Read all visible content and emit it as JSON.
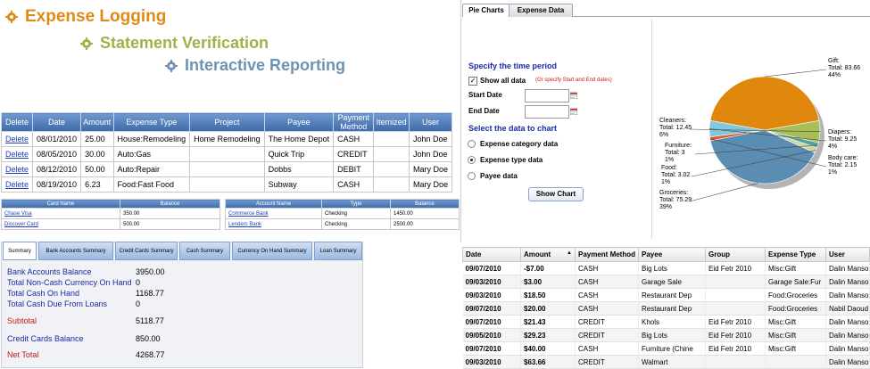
{
  "headings": {
    "h1": "Expense Logging",
    "h2": "Statement Verification",
    "h3": "Interactive Reporting"
  },
  "colors": {
    "h1": "#e08a1a",
    "h2": "#a3b04a",
    "h3": "#6f93b3",
    "header_blue": "#4a78b8",
    "pie_orange": "#e0870d",
    "pie_blue": "#5b8db3"
  },
  "expense_table": {
    "columns": [
      "Delete",
      "Date",
      "Amount",
      "Expense Type",
      "Project",
      "Payee",
      "Payment Method",
      "Itemized",
      "User"
    ],
    "rows": [
      [
        "Delete",
        "08/01/2010",
        "25.00",
        "House:Remodeling",
        "Home Remodeling",
        "The Home Depot",
        "CASH",
        "",
        "John Doe"
      ],
      [
        "Delete",
        "08/05/2010",
        "30.00",
        "Auto:Gas",
        "",
        "Quick Trip",
        "CREDIT",
        "",
        "John Doe"
      ],
      [
        "Delete",
        "08/12/2010",
        "50.00",
        "Auto:Repair",
        "",
        "Dobbs",
        "DEBIT",
        "",
        "Mary Doe"
      ],
      [
        "Delete",
        "08/19/2010",
        "6.23",
        "Food:Fast Food",
        "",
        "Subway",
        "CASH",
        "",
        "Mary Doe"
      ]
    ]
  },
  "card_table": {
    "columns": [
      "Card Name",
      "Balance"
    ],
    "rows": [
      [
        "Chase Visa",
        "350.00"
      ],
      [
        "Discover Card",
        "500.00"
      ]
    ]
  },
  "account_table": {
    "columns": [
      "Account Name",
      "Type",
      "Balance"
    ],
    "rows": [
      [
        "Commerce Bank",
        "Checking",
        "1450.00"
      ],
      [
        "Lenders Bank",
        "Checking",
        "2500.00"
      ]
    ]
  },
  "summary": {
    "tabs": [
      "Summary",
      "Bank Accounts Summary",
      "Credit Cards Summary",
      "Cash Summary",
      "Currency On Hand Summary",
      "Loan Summary"
    ],
    "rows": [
      {
        "label": "Bank Accounts Balance",
        "value": "3950.00"
      },
      {
        "label": "Total Non-Cash Currency On Hand",
        "value": "0"
      },
      {
        "label": "Total Cash On Hand",
        "value": "1168.77"
      },
      {
        "label": "Total Cash Due From Loans",
        "value": "0"
      },
      {
        "label": "Subtotal",
        "value": "5118.77"
      },
      {
        "label": "Credit Cards Balance",
        "value": "850.00"
      },
      {
        "label": "Net Total",
        "value": "4268.77"
      }
    ]
  },
  "chart_panel": {
    "tabs": [
      "Pie Charts",
      "Expense Data"
    ],
    "time_period_title": "Specify the time period",
    "show_all_label": "Show all data",
    "show_all_hint": "(Or specify Start and End dates)",
    "start_date_label": "Start Date",
    "end_date_label": "End Date",
    "select_title": "Select the data to chart",
    "options": [
      "Expense category data",
      "Expense type data",
      "Payee data"
    ],
    "button": "Show Chart"
  },
  "chart_data": {
    "type": "pie",
    "slices": [
      {
        "name": "Gift",
        "total": "83.66",
        "pct": "44%",
        "value": 83.66,
        "color": "#e0870d"
      },
      {
        "name": "Diapers",
        "total": "9.25",
        "pct": "4%",
        "value": 9.25,
        "color": "#82c8dd"
      },
      {
        "name": "Body care",
        "total": "2.15",
        "pct": "1%",
        "value": 2.15,
        "color": "#e0562b"
      },
      {
        "name": "Groceries",
        "total": "75.29",
        "pct": "39%",
        "value": 75.29,
        "color": "#5b8db3"
      },
      {
        "name": "Food",
        "total": "3.02",
        "pct": "1%",
        "value": 3.02,
        "color": "#cbd9a0"
      },
      {
        "name": "Furniture",
        "total": "3",
        "pct": "1%",
        "value": 3,
        "color": "#5aa09b"
      },
      {
        "name": "Cleaners",
        "total": "12.45",
        "pct": "6%",
        "value": 12.45,
        "color": "#a8bf58"
      }
    ],
    "total_prefix": "Total: "
  },
  "data_grid": {
    "columns": [
      "Date",
      "Amount",
      "Payment Method",
      "Payee",
      "Group",
      "Expense Type",
      "User"
    ],
    "rows": [
      [
        "09/07/2010",
        "-$7.00",
        "CASH",
        "Big Lots",
        "Eid Fetr 2010",
        "Misc:Gift",
        "Dalin Mansour"
      ],
      [
        "09/03/2010",
        "$3.00",
        "CASH",
        "Garage Sale",
        "",
        "Garage Sale:Fur",
        "Dalin Mansour"
      ],
      [
        "09/03/2010",
        "$18.50",
        "CASH",
        "Restaurant Dep",
        "",
        "Food:Groceries",
        "Dalin Mansour"
      ],
      [
        "09/07/2010",
        "$20.00",
        "CASH",
        "Restaurant Dep",
        "",
        "Food:Groceries",
        "Nabil Daoud"
      ],
      [
        "09/07/2010",
        "$21.43",
        "CREDIT",
        "Khols",
        "Eid Fetr 2010",
        "Misc:Gift",
        "Dalin Mansour"
      ],
      [
        "09/05/2010",
        "$29.23",
        "CREDIT",
        "Big Lots",
        "Eid Fetr 2010",
        "Misc:Gift",
        "Dalin Mansour"
      ],
      [
        "09/07/2010",
        "$40.00",
        "CASH",
        "Furniture (Chine",
        "Eid Fetr 2010",
        "Misc:Gift",
        "Dalin Mansour"
      ],
      [
        "09/03/2010",
        "$63.66",
        "CREDIT",
        "Walmart",
        "",
        "",
        "Dalin Mansour"
      ]
    ]
  }
}
